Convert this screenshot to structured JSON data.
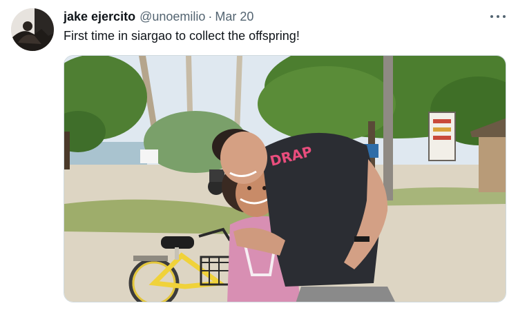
{
  "tweet": {
    "author_name": "jake ejercito",
    "handle": "@unoemilio",
    "separator": "·",
    "date": "Mar 20",
    "text": "First time in siargao to collect the offspring!",
    "shirt_text": "DRAP"
  },
  "colors": {
    "text_primary": "#0f1419",
    "text_secondary": "#536471",
    "border": "#cfd9de"
  },
  "icons": {
    "more": "more-horizontal-icon"
  }
}
